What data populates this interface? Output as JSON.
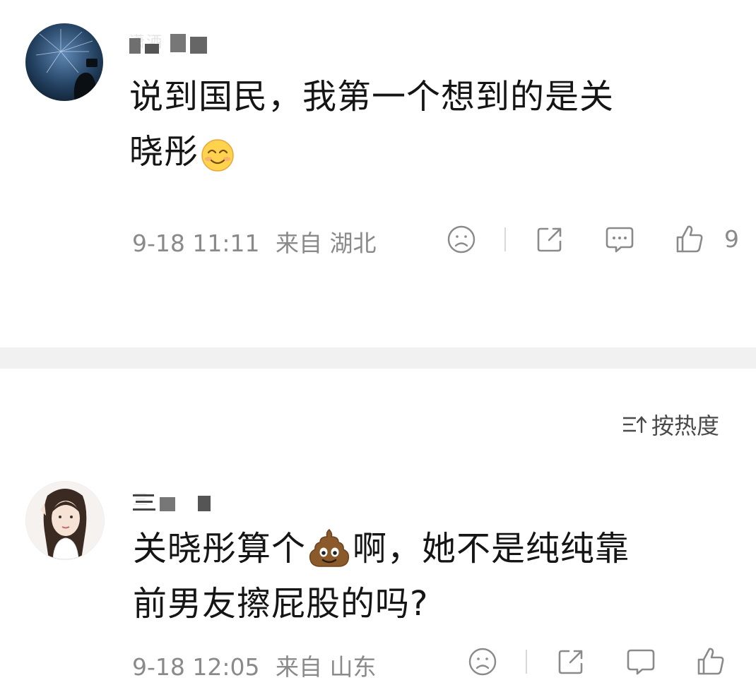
{
  "comments": [
    {
      "username": "潇洒",
      "text_line1": "说到国民，我第一个想到的是关",
      "text_line2": "晓彤",
      "date": "9-18 11:11",
      "location": "来自 湖北",
      "likes": "9"
    },
    {
      "username": "三",
      "text_line1a": "关晓彤算个",
      "text_line1b": "啊，她不是纯纯靠",
      "text_line2": "前男友擦屁股的吗?",
      "date": "9-18 12:05",
      "location": "来自 山东"
    }
  ],
  "sort": {
    "label": "按热度"
  },
  "icons": {
    "dislike": "sad-face-icon",
    "share": "share-icon",
    "comment": "comment-bubble-icon",
    "like": "thumbs-up-icon",
    "emoji_smile": "smile-emoji-icon",
    "emoji_poop": "poop-emoji-icon"
  },
  "colors": {
    "text": "#151515",
    "meta": "#8a8a8a",
    "band": "#f1f1f1"
  }
}
